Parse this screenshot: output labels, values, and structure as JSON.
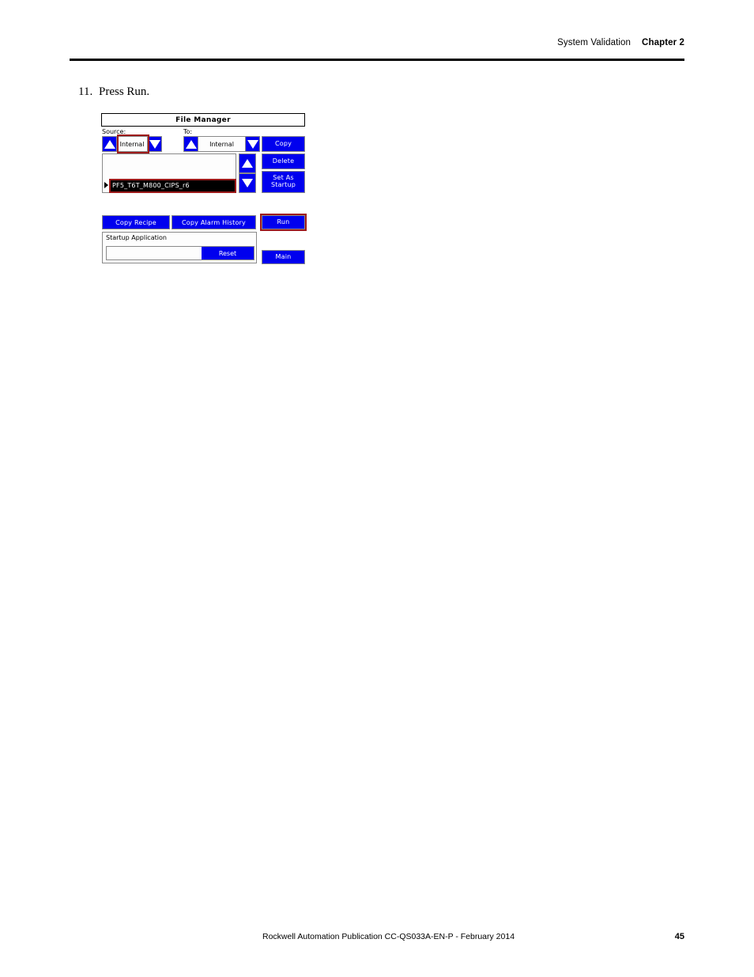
{
  "page": {
    "header": {
      "section": "System Validation",
      "chapter": "Chapter 2"
    },
    "step": {
      "number": "11.",
      "text": "Press Run."
    },
    "footer": {
      "publication": "Rockwell Automation Publication CC-QS033A-EN-P - February 2014",
      "page_number": "45"
    }
  },
  "file_manager": {
    "title": "File Manager",
    "source": {
      "label": "Source:",
      "value": "Internal",
      "up_icon": "triangle-up-icon",
      "down_icon": "triangle-down-icon"
    },
    "destination": {
      "label": "To:",
      "value": "Internal",
      "up_icon": "triangle-up-icon",
      "down_icon": "triangle-down-icon"
    },
    "file_list": {
      "selected_file": "PF5_T6T_M800_CIPS_r6",
      "caret_icon": "caret-right-icon",
      "scroll_up_icon": "triangle-up-icon",
      "scroll_down_icon": "triangle-down-icon"
    },
    "buttons": {
      "copy": "Copy",
      "delete": "Delete",
      "set_as_startup": "Set As Startup",
      "run": "Run",
      "main": "Main",
      "copy_recipe": "Copy Recipe",
      "copy_alarm_history": "Copy Alarm History"
    },
    "startup_application": {
      "label": "Startup Application",
      "value": "",
      "reset_label": "Reset"
    },
    "colors": {
      "button_blue": "#0000ee",
      "button_text": "#ffffff",
      "highlight_red": "#9e1b1b",
      "list_selection_bg": "#000000"
    }
  }
}
